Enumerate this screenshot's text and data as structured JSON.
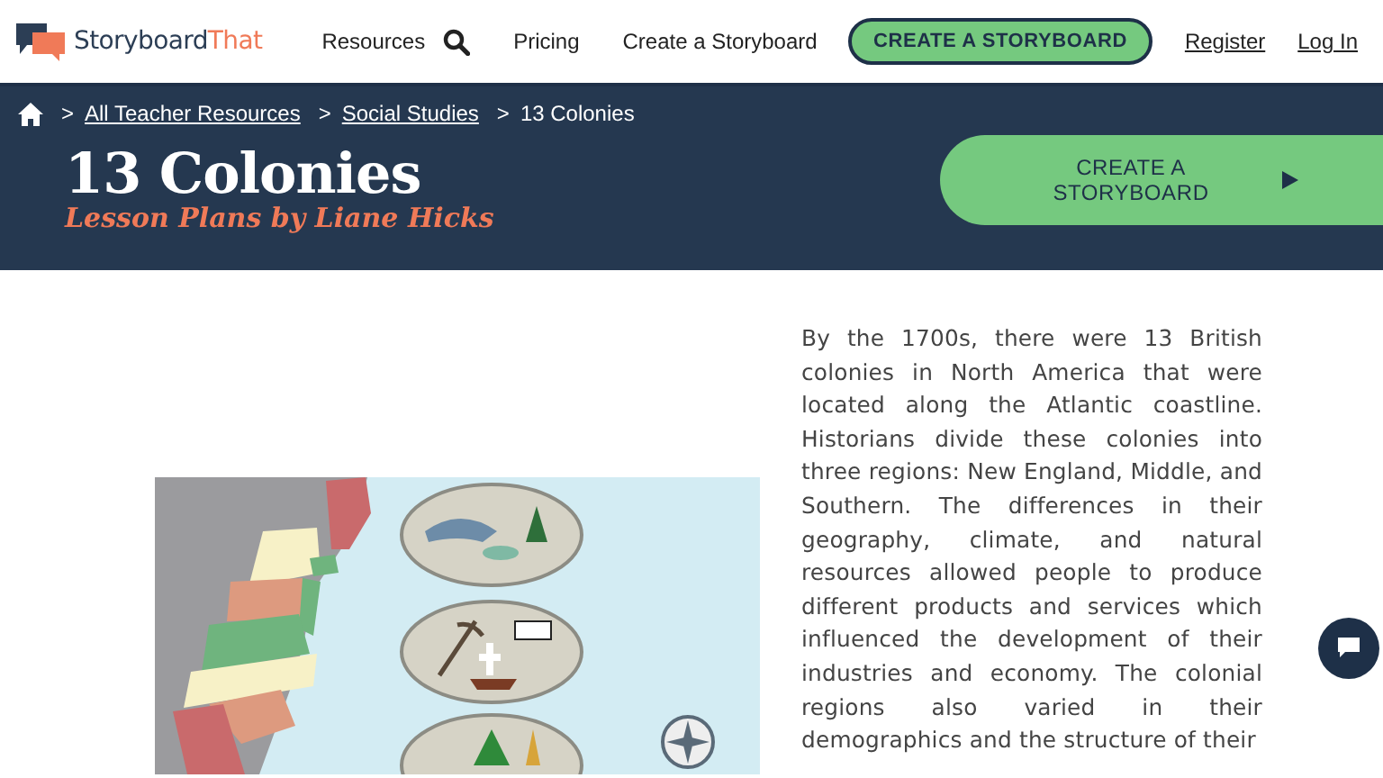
{
  "header": {
    "logo": {
      "word_1": "Storyboard",
      "word_2": "That"
    },
    "nav": [
      {
        "label": "Resources",
        "kind": "link"
      },
      {
        "kind": "search"
      },
      {
        "label": "Pricing",
        "kind": "link"
      },
      {
        "label": "Create a Storyboard",
        "kind": "link"
      }
    ],
    "cta": "CREATE A STORYBOARD",
    "account_links": [
      "Register",
      "Log In"
    ]
  },
  "breadcrumbs": [
    {
      "separator": ">",
      "label": "All Teacher Resources",
      "link": true
    },
    {
      "separator": ">",
      "label": "Social Studies",
      "link": true
    },
    {
      "separator": ">",
      "label": "13 Colonies",
      "link": false
    }
  ],
  "hero": {
    "title": "13 Colonies",
    "subtitle": "Lesson Plans by Liane Hicks",
    "button": "CREATE A STORYBOARD"
  },
  "intro": "By the 1700s, there were 13 British colonies in North America that were located along the Atlantic coastline. Historians divide these colonies into three regions: New England, Middle, and Southern. The differences in their geography, climate, and natural resources allowed people to produce different products and services which influenced the development of their industries and economy. The colonial regions also varied in their demographics and the structure of their"
}
